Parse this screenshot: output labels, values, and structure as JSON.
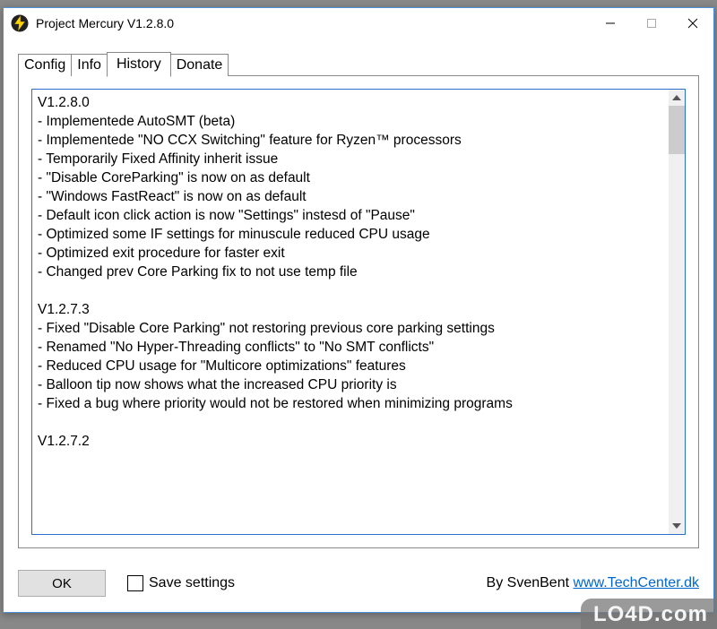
{
  "titlebar": {
    "title": "Project Mercury V1.2.8.0"
  },
  "tabs": {
    "items": [
      {
        "label": "Config"
      },
      {
        "label": "Info"
      },
      {
        "label": "History"
      },
      {
        "label": "Donate"
      }
    ],
    "active_index": 2
  },
  "history": {
    "blocks": [
      {
        "version": "V1.2.8.0",
        "lines": [
          "- Implementede AutoSMT (beta)",
          "- Implementede \"NO CCX Switching\" feature for Ryzen™ processors",
          "- Temporarily Fixed Affinity inherit issue",
          "- \"Disable CoreParking\" is now on as default",
          "- \"Windows FastReact\" is now on as default",
          "- Default icon click action is now \"Settings\" instesd of \"Pause\"",
          "- Optimized some IF settings for minuscule reduced CPU usage",
          "- Optimized exit procedure for faster exit",
          "- Changed prev Core Parking fix to not use temp file"
        ]
      },
      {
        "version": "V1.2.7.3",
        "lines": [
          "- Fixed \"Disable Core Parking\" not restoring previous core parking settings",
          "- Renamed \"No Hyper-Threading conflicts\" to \"No SMT conflicts\"",
          "- Reduced CPU usage for \"Multicore optimizations\" features",
          "- Balloon tip now shows what the increased CPU priority is",
          "- Fixed a bug where priority would not be restored when minimizing programs"
        ]
      },
      {
        "version": "V1.2.7.2",
        "lines": []
      }
    ]
  },
  "bottom": {
    "ok_label": "OK",
    "save_settings_label": "Save settings",
    "credits_prefix": "By SvenBent ",
    "credits_link": "www.TechCenter.dk"
  },
  "watermark": "LO4D.com"
}
